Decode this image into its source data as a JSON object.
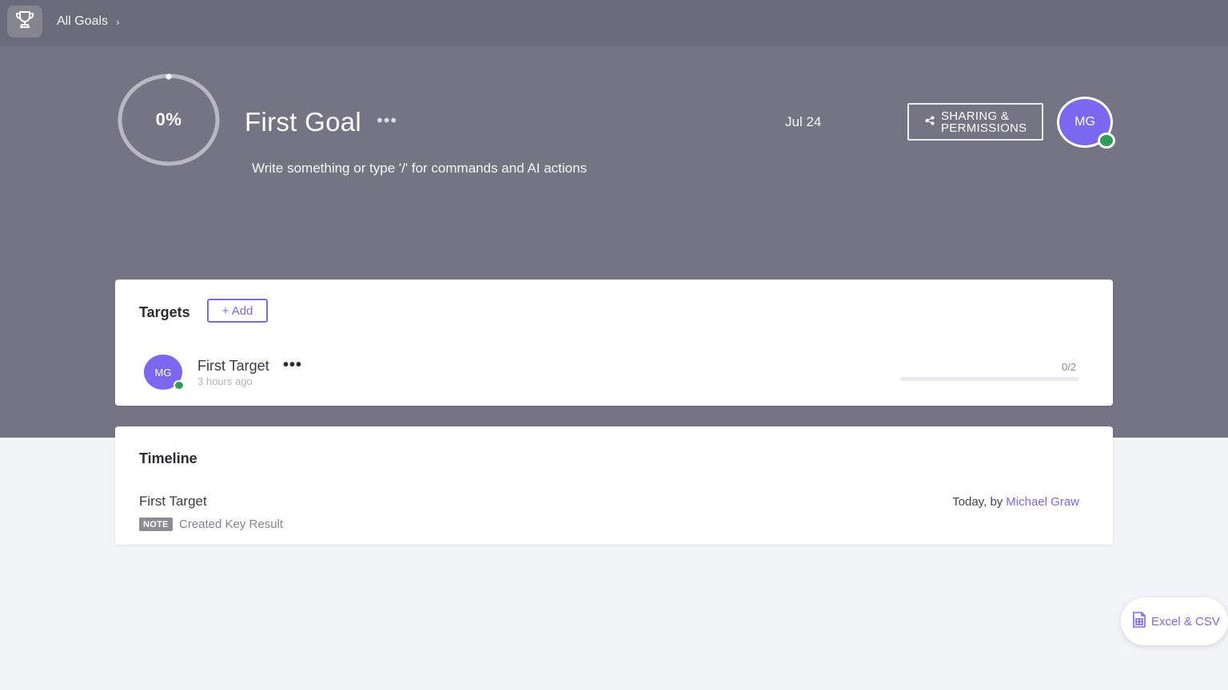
{
  "breadcrumb": {
    "label": "All Goals"
  },
  "goal": {
    "progress_label": "0%",
    "progress": 0,
    "title": "First Goal",
    "description_placeholder": "Write something or type '/' for commands and AI actions",
    "due_date": "Jul 24",
    "share_label_1": "SHARING &",
    "share_label_2": "PERMISSIONS",
    "owner_initials": "MG"
  },
  "targets": {
    "heading": "Targets",
    "add_label": "+ Add",
    "items": [
      {
        "initials": "MG",
        "name": "First Target",
        "time": "3 hours ago",
        "count": "0/2",
        "progress": 0
      }
    ]
  },
  "timeline": {
    "heading": "Timeline",
    "entries": [
      {
        "title": "First Target",
        "tag": "NOTE",
        "action": "Created Key Result",
        "when": "Today, by",
        "author": "Michael Graw"
      }
    ]
  },
  "export": {
    "label": "Excel & CSV"
  },
  "colors": {
    "accent": "#7b68ee",
    "presence": "#2e9e58",
    "hero_bg": "#757482",
    "topbar_bg": "#6b6a78"
  }
}
